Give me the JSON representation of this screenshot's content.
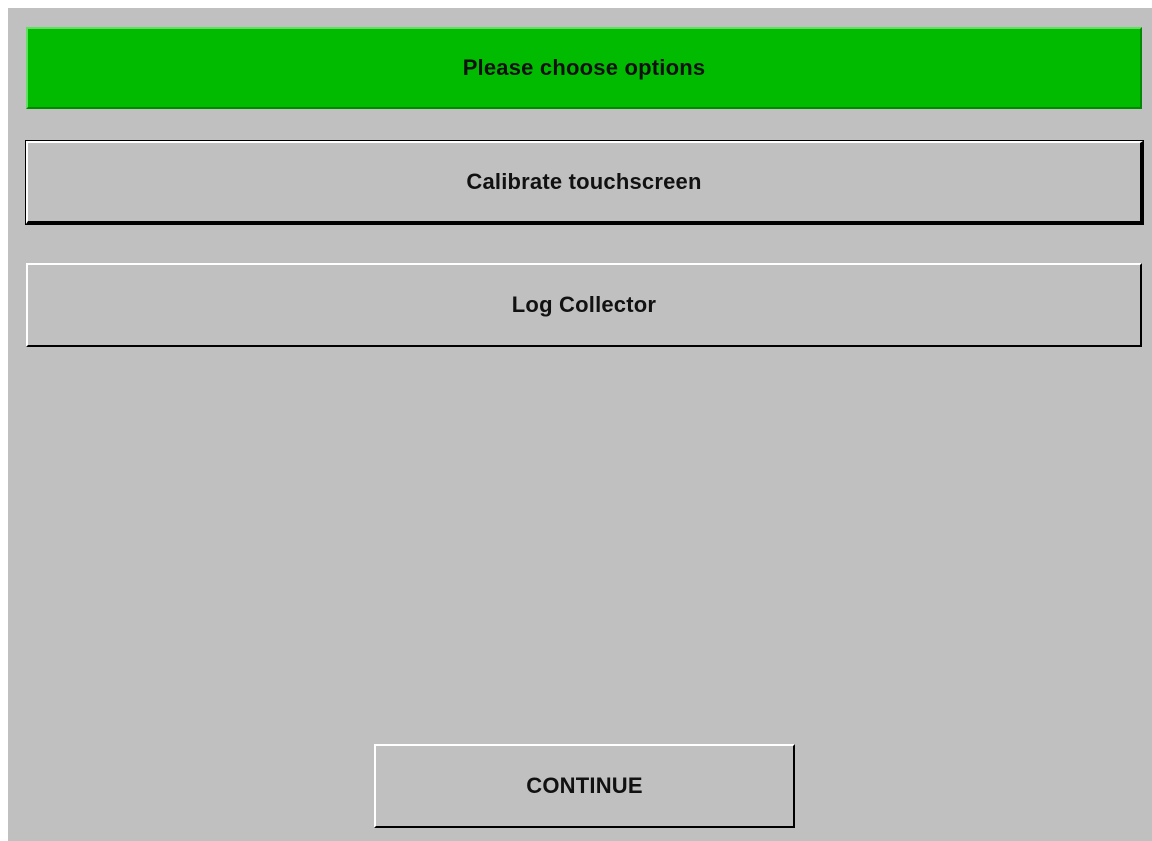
{
  "header": {
    "title": "Please choose options",
    "color": "#00bb00"
  },
  "options": {
    "calibrate_label": "Calibrate touchscreen",
    "log_collector_label": "Log Collector"
  },
  "footer": {
    "continue_label": "CONTINUE"
  },
  "colors": {
    "background": "#c0c0c0",
    "banner": "#00bb00"
  }
}
